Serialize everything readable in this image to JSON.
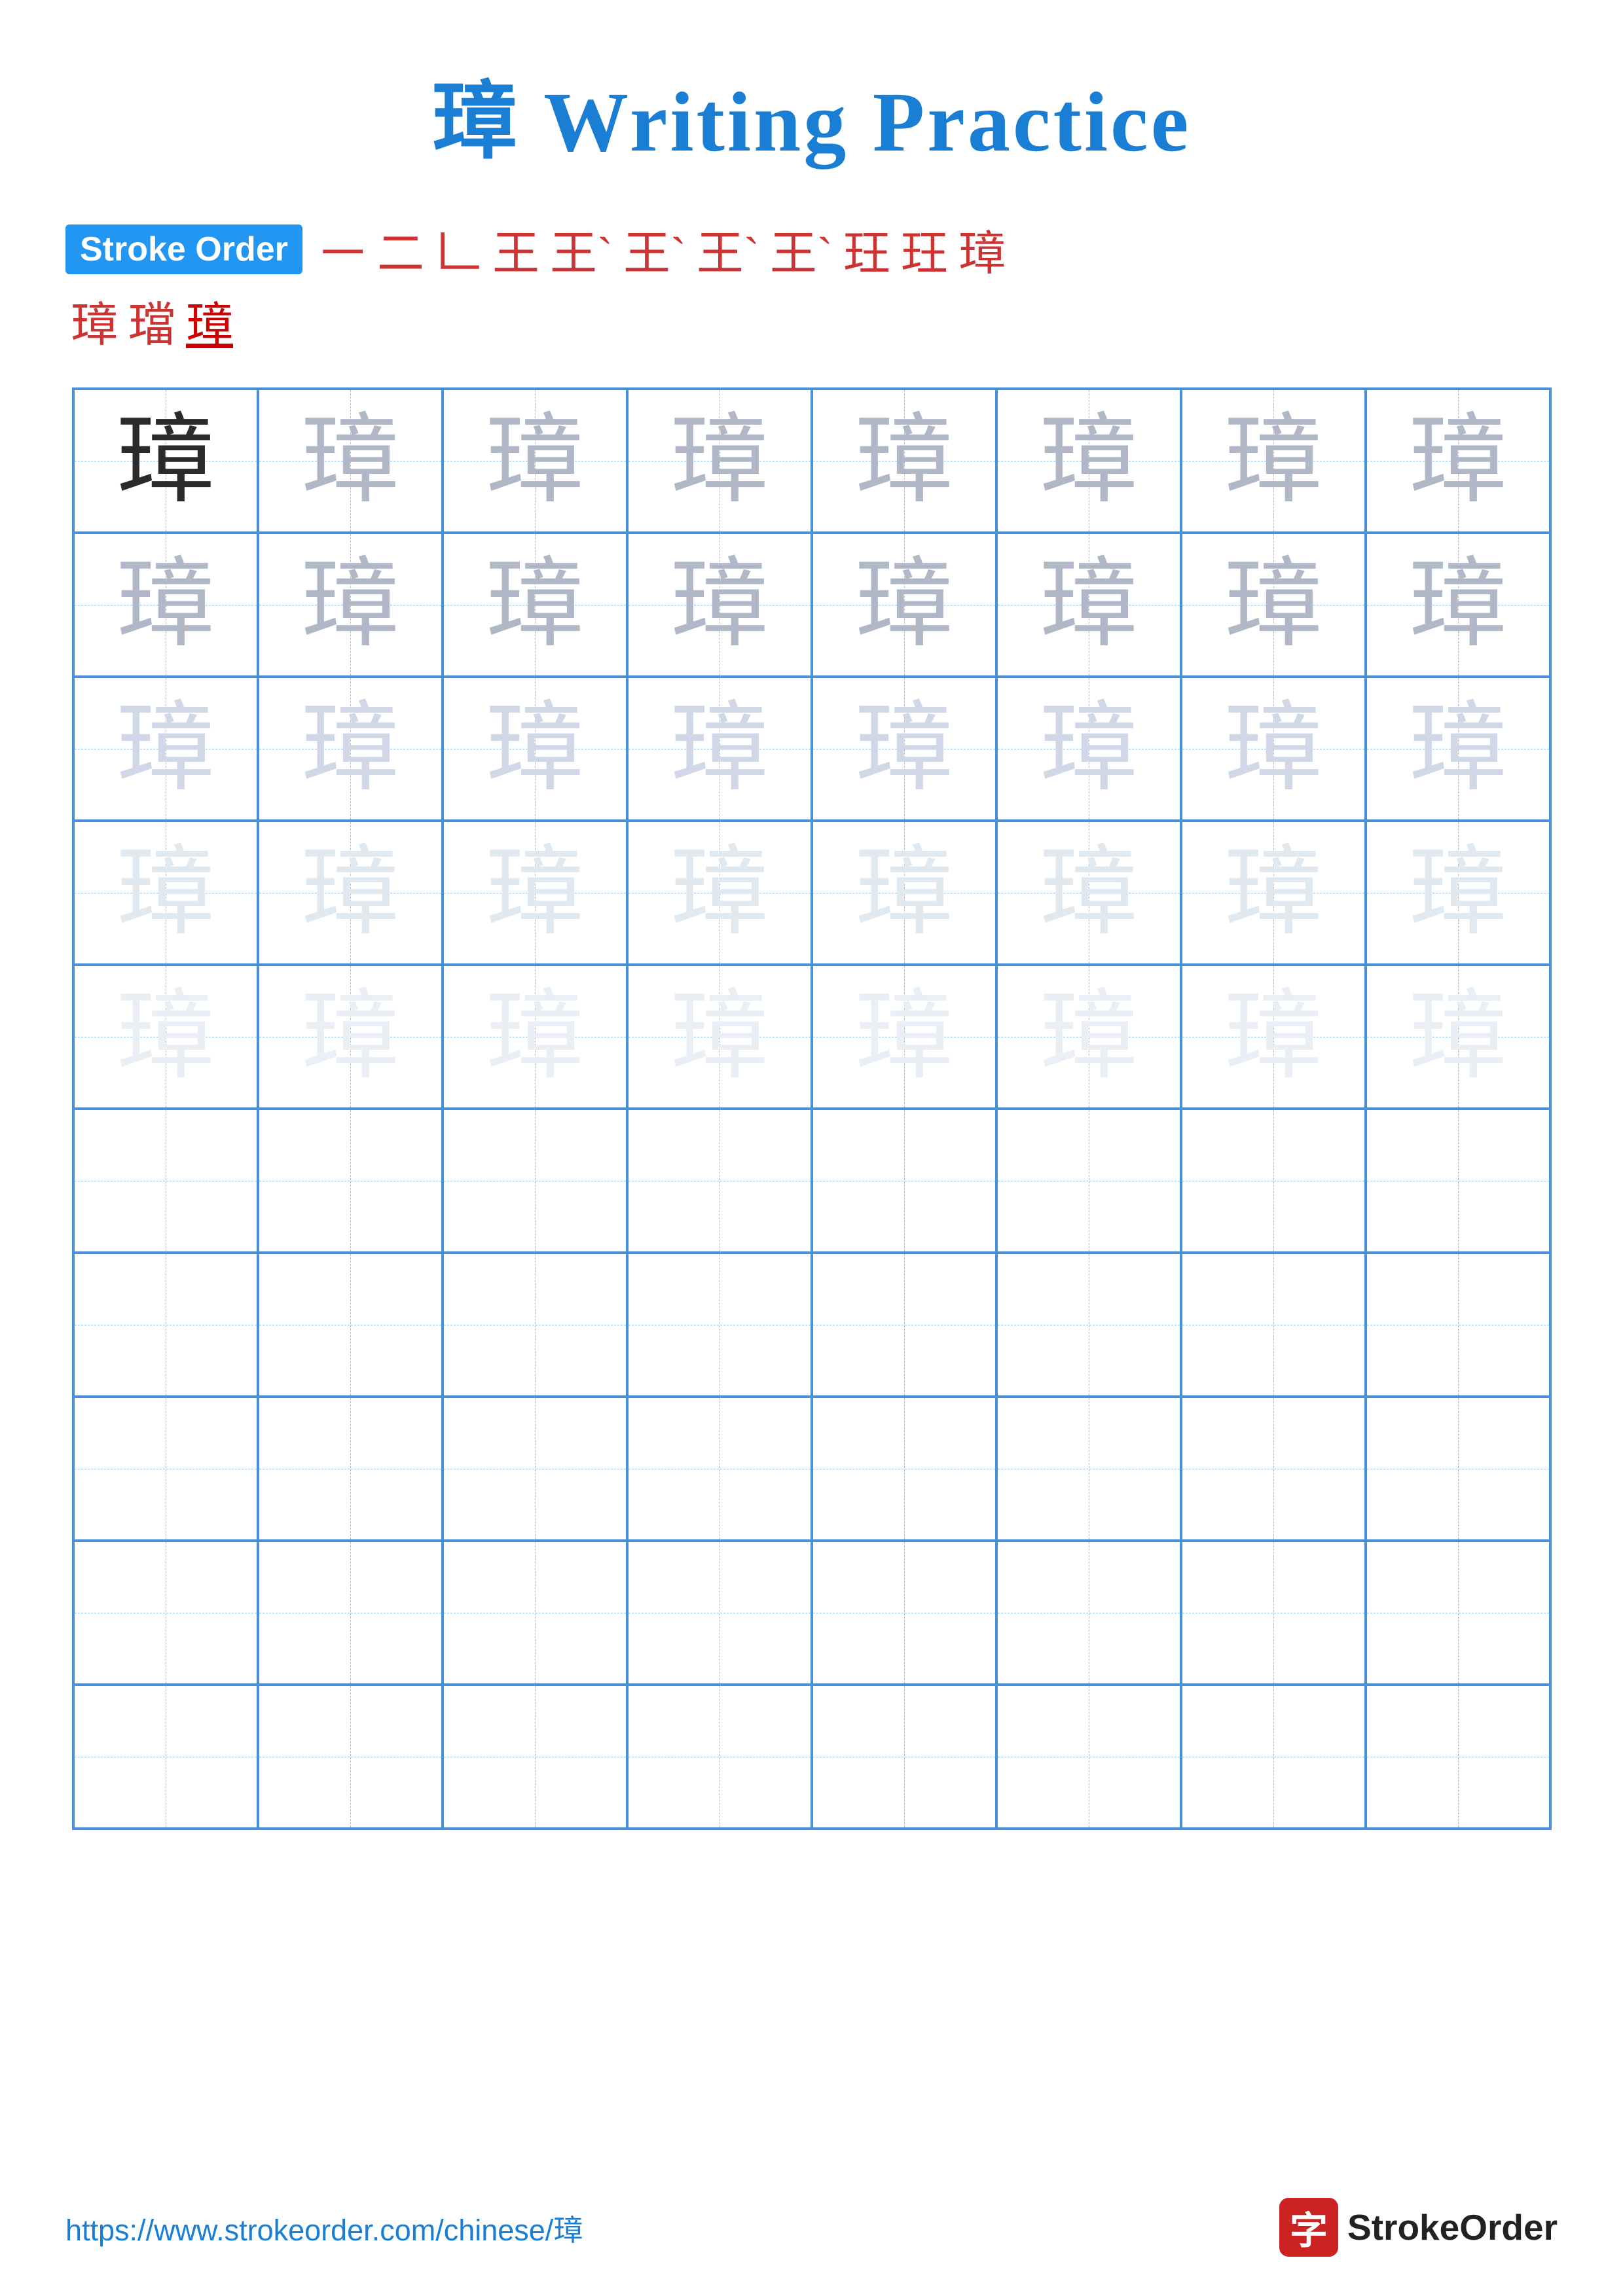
{
  "title": {
    "char": "璋",
    "suffix": " Writing Practice"
  },
  "stroke_order": {
    "label": "Stroke Order",
    "chars_row1": [
      "㇐",
      "二",
      "𠃊",
      "王",
      "王`",
      "王`",
      "王`",
      "王`",
      "玨",
      "玨",
      "璋"
    ],
    "chars_row2": [
      "璋",
      "璫",
      "璋"
    ]
  },
  "grid": {
    "char": "璋",
    "rows": 10,
    "cols": 8,
    "filled_rows": 5,
    "shades": [
      "dark",
      "medium",
      "medium",
      "light",
      "lighter"
    ]
  },
  "footer": {
    "url": "https://www.strokeorder.com/chinese/璋",
    "logo_char": "字",
    "logo_text": "StrokeOrder"
  }
}
